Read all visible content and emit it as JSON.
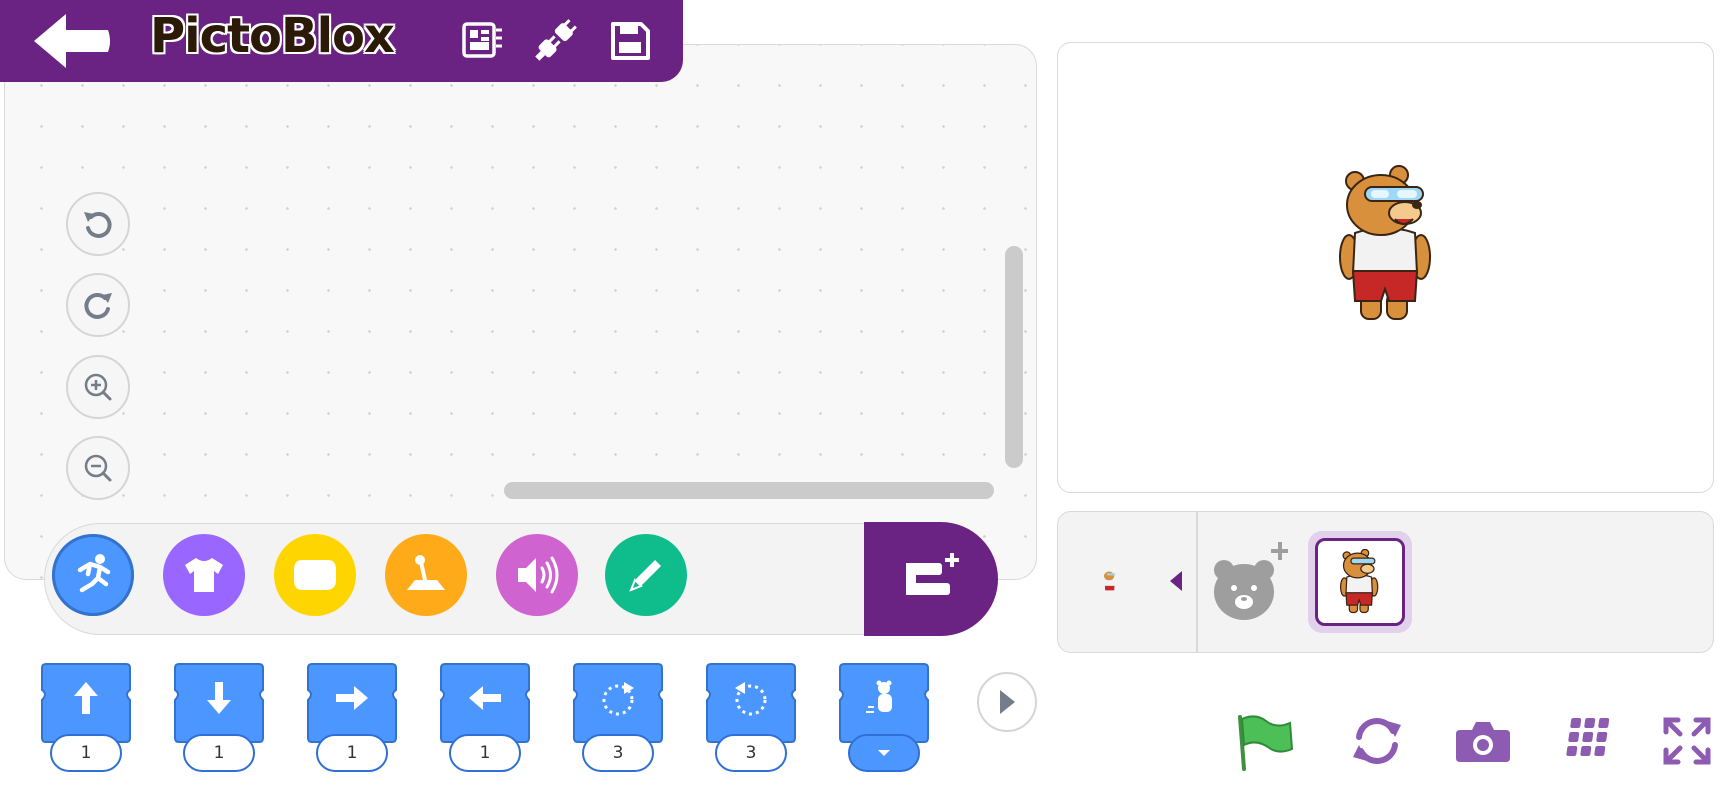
{
  "app": {
    "title": "PictoBlox"
  },
  "header": {
    "icons": [
      "back-arrow-icon",
      "board-icon",
      "connect-plug-icon",
      "save-icon"
    ]
  },
  "workspace": {
    "zoom_controls": [
      "undo-icon",
      "redo-icon",
      "zoom-in-icon",
      "zoom-out-icon"
    ]
  },
  "categories": [
    {
      "name": "motion",
      "icon": "running-figure-icon",
      "color": "#4c97ff",
      "selected": true
    },
    {
      "name": "looks",
      "icon": "shirt-icon",
      "color": "#9966ff"
    },
    {
      "name": "display",
      "icon": "speech-bubble-icon",
      "color": "#ffd500"
    },
    {
      "name": "control",
      "icon": "joystick-icon",
      "color": "#ffab19"
    },
    {
      "name": "sound",
      "icon": "speaker-icon",
      "color": "#cf63cf"
    },
    {
      "name": "pen",
      "icon": "pen-icon",
      "color": "#0fbd8c"
    }
  ],
  "extension_button": {
    "icon": "add-extension-icon",
    "color": "#6a2383"
  },
  "blocks": [
    {
      "icon": "arrow-up-icon",
      "value": "1"
    },
    {
      "icon": "arrow-down-icon",
      "value": "1"
    },
    {
      "icon": "arrow-right-icon",
      "value": "1"
    },
    {
      "icon": "arrow-left-icon",
      "value": "1"
    },
    {
      "icon": "rotate-clockwise-icon",
      "value": "3"
    },
    {
      "icon": "rotate-counterclockwise-icon",
      "value": "3"
    },
    {
      "icon": "go-to-sprite-icon",
      "value": ""
    }
  ],
  "stage": {
    "sprite": "bear-sprite"
  },
  "sprite_panel": {
    "sprites": [
      "bear-sprite"
    ],
    "selected_sprite": "bear-sprite"
  },
  "stage_controls": [
    "green-flag-icon",
    "reset-icon",
    "camera-icon",
    "grid-icon",
    "fullscreen-icon"
  ],
  "colors": {
    "brand_purple": "#6a2383",
    "block_blue": "#4c97ff",
    "block_border": "#2f6fd6"
  }
}
